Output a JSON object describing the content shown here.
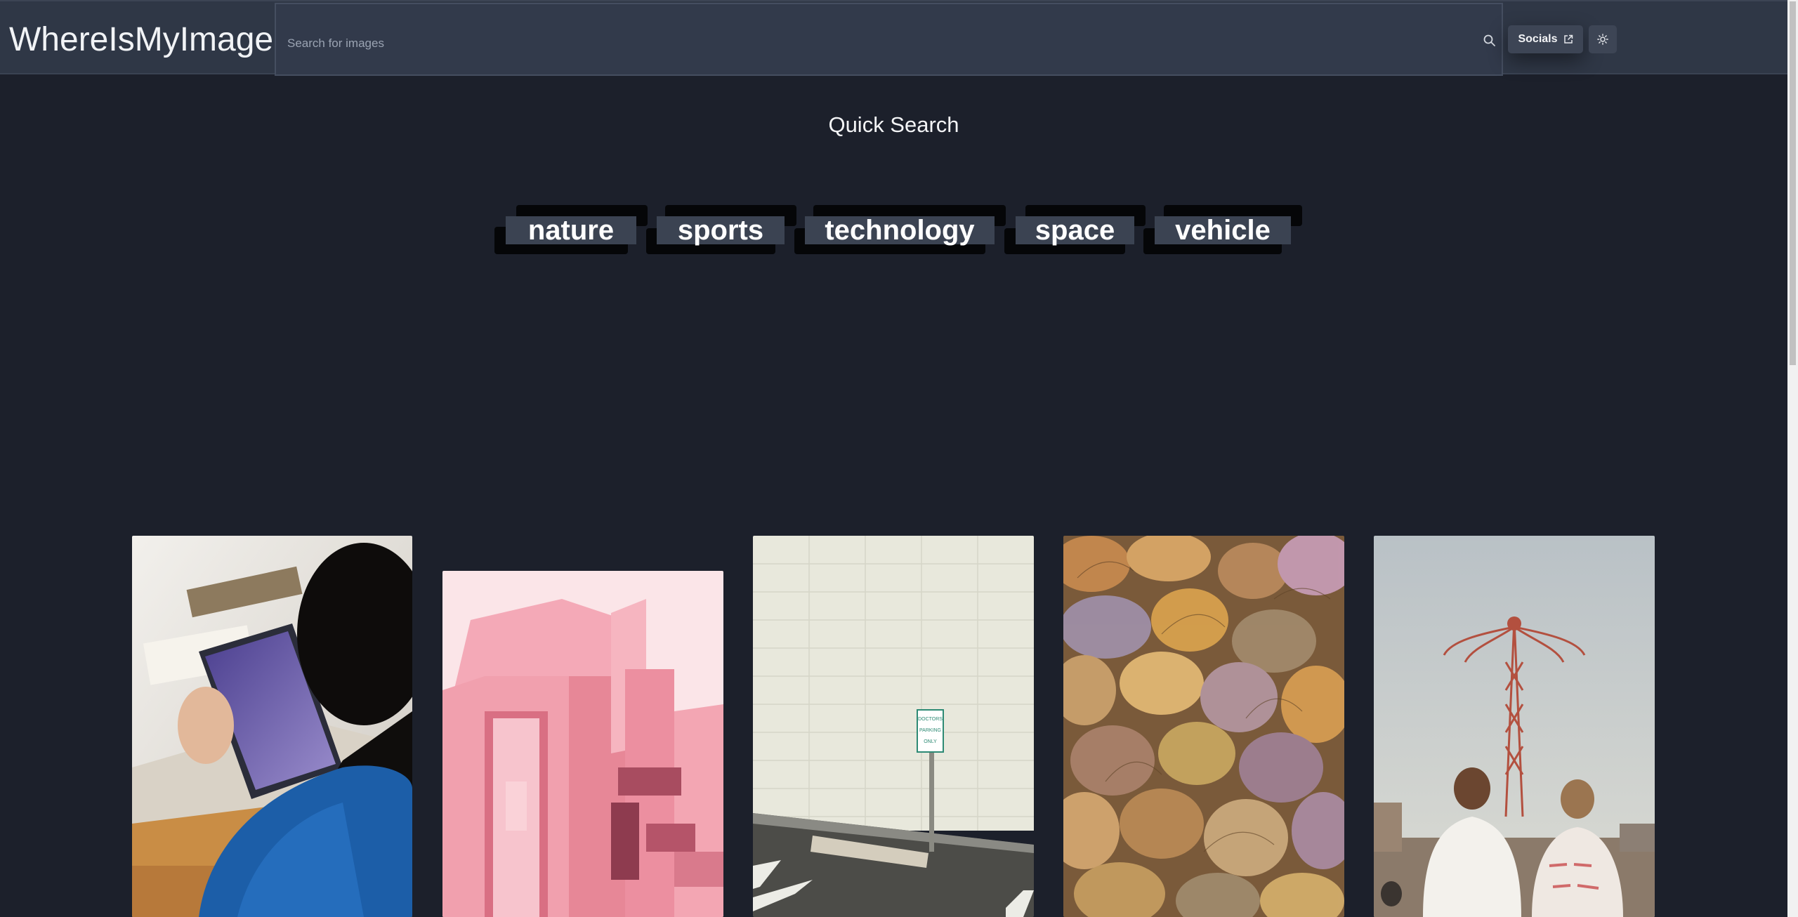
{
  "header": {
    "logo": "WhereIsMyImage",
    "search_placeholder": "Search for images",
    "socials_label": "Socials",
    "icons": [
      "search-icon",
      "external-link-icon",
      "sun-icon"
    ]
  },
  "quick_search": {
    "title": "Quick Search",
    "tags": [
      "nature",
      "sports",
      "technology",
      "space",
      "vehicle"
    ]
  },
  "gallery": {
    "images": [
      {
        "subject": "person holding a tablet"
      },
      {
        "subject": "pink building"
      },
      {
        "subject": "doctors parking only sign"
      },
      {
        "subject": "dried rose petals"
      },
      {
        "subject": "parachute tower with people"
      }
    ],
    "sign_text": "DOCTORS PARKING ONLY"
  },
  "colors": {
    "background": "#1c202b",
    "header": "#2f3746",
    "tag": "#3b4352"
  }
}
